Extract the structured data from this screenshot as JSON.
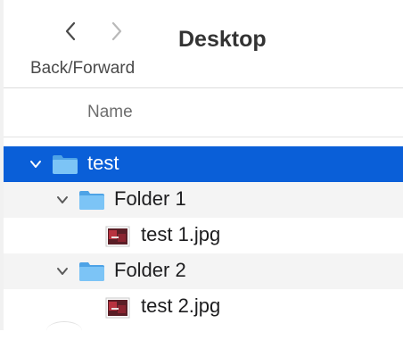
{
  "toolbar": {
    "nav_label": "Back/Forward",
    "title": "Desktop"
  },
  "columns": {
    "name": "Name"
  },
  "rows": [
    {
      "label": "test",
      "kind": "folder",
      "expanded": true,
      "selected": true
    },
    {
      "label": "Folder 1",
      "kind": "folder",
      "expanded": true,
      "selected": false
    },
    {
      "label": "test 1.jpg",
      "kind": "image",
      "selected": false
    },
    {
      "label": "Folder 2",
      "kind": "folder",
      "expanded": true,
      "selected": false
    },
    {
      "label": "test 2.jpg",
      "kind": "image",
      "selected": false
    }
  ],
  "colors": {
    "selection": "#0a5fd8",
    "folder": "#6ab7f2",
    "alt_row": "#f4f4f4"
  },
  "icons": {
    "back": "chevron-left-icon",
    "forward": "chevron-right-icon",
    "disclosure": "chevron-down-icon",
    "folder": "folder-icon",
    "image": "image-thumbnail-icon"
  }
}
